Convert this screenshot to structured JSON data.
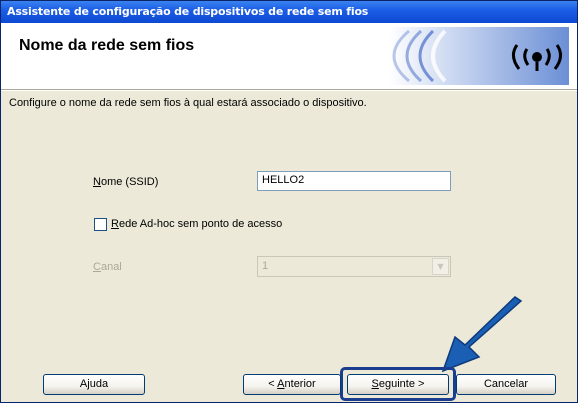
{
  "window": {
    "title": "Assistente de configuração de dispositivos de rede sem fios"
  },
  "header": {
    "heading": "Nome da rede sem fios",
    "logo_icon": "wireless-signal-icon"
  },
  "description": "Configure o nome da rede sem fios à qual estará associado o dispositivo.",
  "form": {
    "ssid_label_mnemonic": "N",
    "ssid_label_rest": "ome (SSID)",
    "ssid_value": "HELLO2",
    "adhoc_checked": false,
    "adhoc_label_mnemonic": "R",
    "adhoc_label_rest": "ede Ad-hoc sem ponto de acesso",
    "canal_label_mnemonic": "C",
    "canal_label_rest": "anal",
    "canal_value": "1",
    "canal_enabled": false
  },
  "buttons": {
    "help": "Ajuda",
    "back_prefix": "< ",
    "back_mnemonic": "A",
    "back_rest": "nterior",
    "next_mnemonic": "S",
    "next_rest": "eguinte >",
    "cancel": "Cancelar"
  },
  "colors": {
    "titlebar": "#0d49d2",
    "dialog_bg": "#ece9d8",
    "annotation_arrow": "#1a5fb4",
    "highlight_border": "#1a3d8f"
  }
}
